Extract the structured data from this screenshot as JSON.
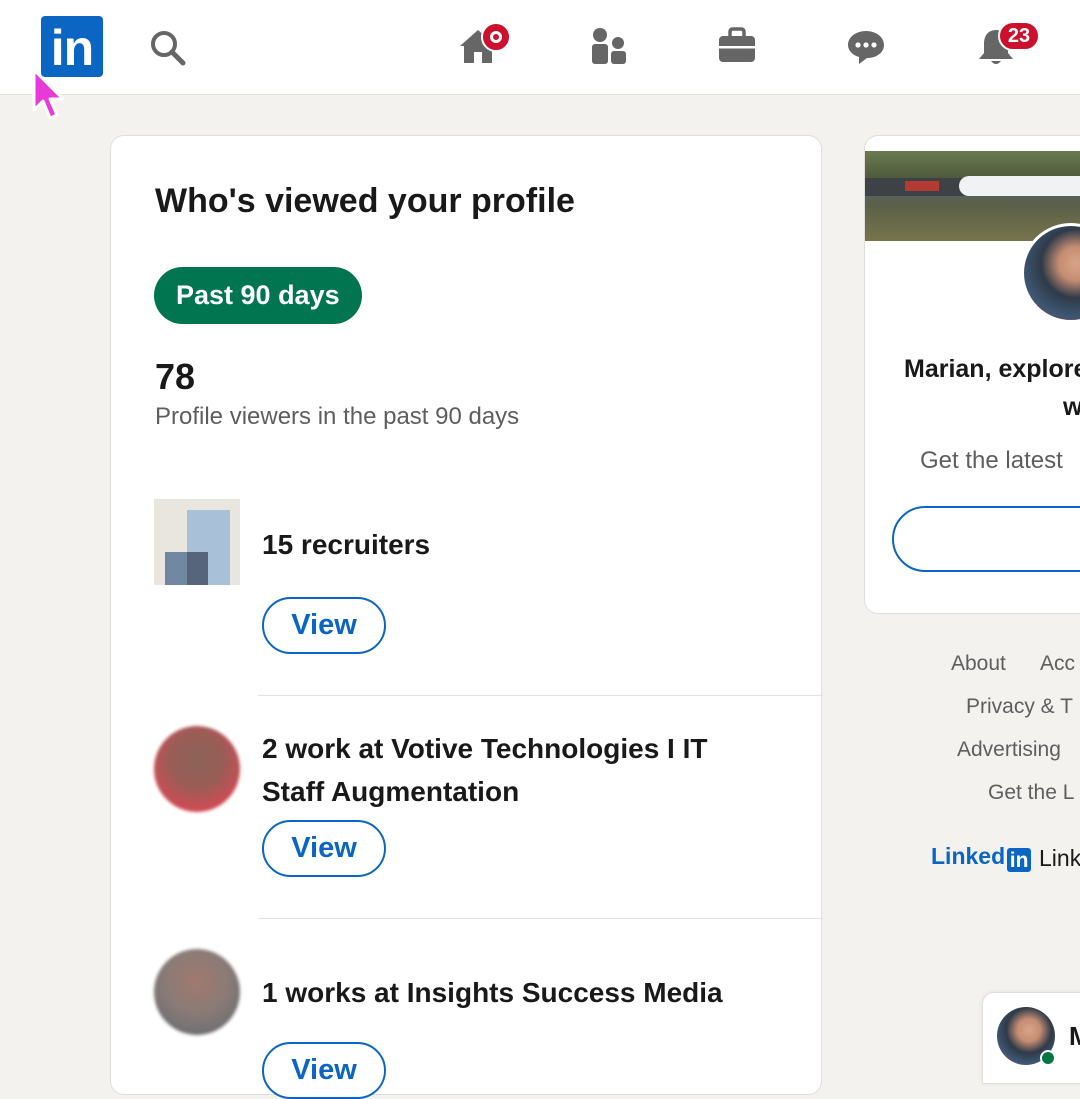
{
  "nav": {
    "logo_text": "in",
    "notifications_count": "23",
    "icons": [
      "linkedin-logo",
      "search-icon",
      "home-icon",
      "my-network-icon",
      "jobs-icon",
      "messaging-icon",
      "notifications-icon"
    ]
  },
  "viewers_card": {
    "title": "Who's viewed your profile",
    "filter_label": "Past 90 days",
    "viewer_count": "78",
    "viewer_count_caption": "Profile viewers in the past 90 days",
    "items": [
      {
        "text": "15 recruiters",
        "button": "View"
      },
      {
        "text": "2 work at  Votive Technologies I IT Staff Augmentation",
        "button": "View"
      },
      {
        "text": "1 works at  Insights Success Media",
        "button": "View"
      }
    ]
  },
  "right_card": {
    "headline_line1": "Marian, explore",
    "headline_line2": "w",
    "subtext": "Get the latest"
  },
  "footer": {
    "links": [
      "About",
      "Acc",
      "Privacy & T",
      "Advertising",
      "Get the L"
    ],
    "brand": "Linked",
    "brand_badge": "in",
    "brand_tail": "Link"
  },
  "messaging": {
    "name": "M"
  },
  "colors": {
    "brand_blue": "#0a66c2",
    "filter_green": "#01754f",
    "badge_red": "#cb112d",
    "page_bg": "#f4f2ee"
  }
}
